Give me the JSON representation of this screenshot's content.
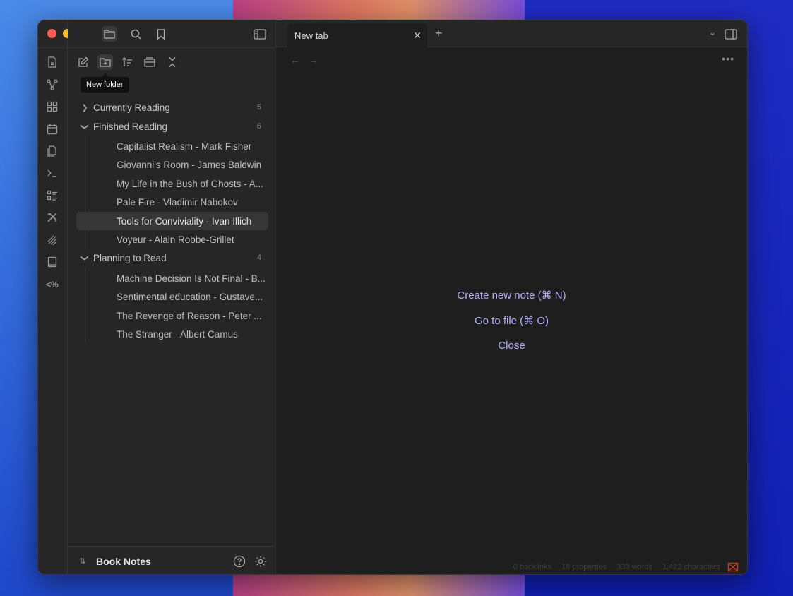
{
  "window": {
    "tab_title": "New tab",
    "vault_name": "Book Notes"
  },
  "toolbar": {
    "tooltip": "New folder"
  },
  "tree": {
    "folders": [
      {
        "name": "Currently Reading",
        "count": "5",
        "expanded": false
      },
      {
        "name": "Finished Reading",
        "count": "6",
        "expanded": true
      },
      {
        "name": "Planning to Read",
        "count": "4",
        "expanded": true
      }
    ],
    "finished": [
      "Capitalist Realism - Mark Fisher",
      "Giovanni's Room - James Baldwin",
      "My Life in the Bush of Ghosts - A...",
      "Pale Fire - Vladimir Nabokov",
      "Tools for Conviviality - Ivan Illich",
      "Voyeur - Alain Robbe-Grillet"
    ],
    "planning": [
      "Machine Decision Is Not Final - B...",
      "Sentimental education - Gustave...",
      "The Revenge of Reason - Peter ...",
      "The Stranger - Albert Camus"
    ],
    "active_item": "Tools for Conviviality - Ivan Illich"
  },
  "main": {
    "actions": [
      "Create new note (⌘ N)",
      "Go to file (⌘ O)",
      "Close"
    ]
  },
  "status": {
    "backlinks": "0 backlinks",
    "properties": "18 properties",
    "words": "333 words",
    "characters": "1,422 characters"
  },
  "colors": {
    "accent_link": "#b7b2ff",
    "background_main": "#1e1e1e",
    "background_sidebar": "#262626"
  }
}
